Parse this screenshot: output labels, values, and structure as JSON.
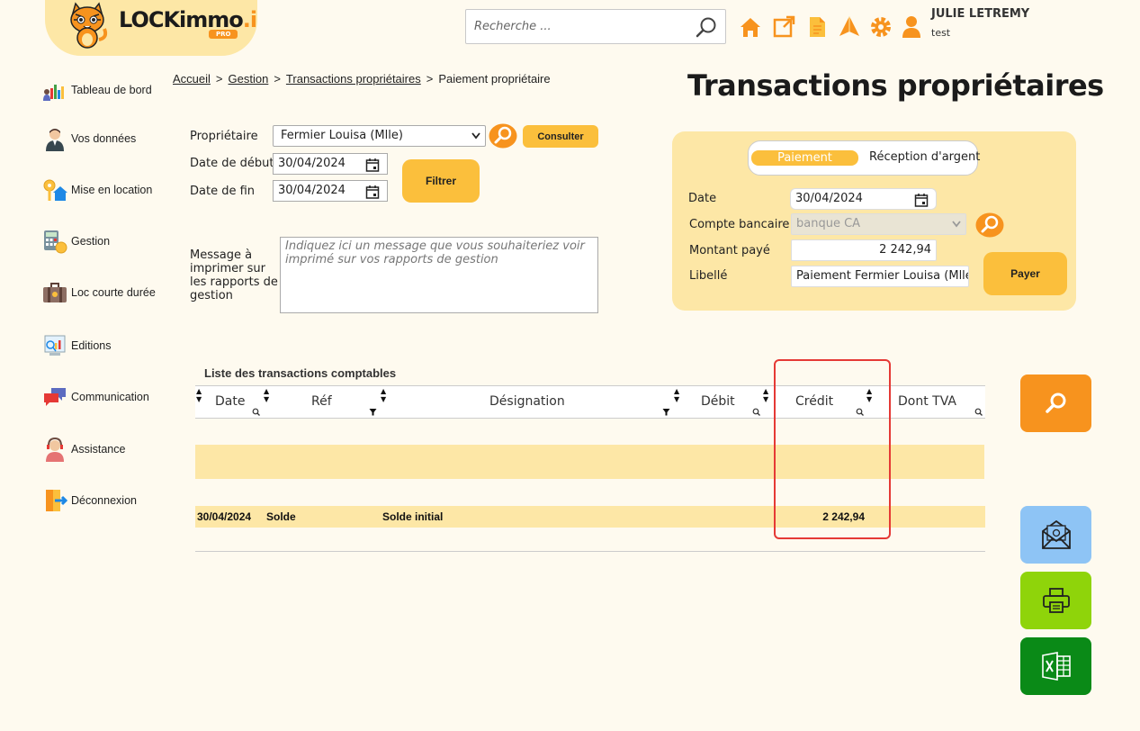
{
  "header": {
    "logo_text": "LOCKimmo",
    "logo_suffix": ".io",
    "logo_badge": "PRO",
    "search_placeholder": "Recherche ...",
    "user_name": "JULIE LETREMY",
    "user_sub": "test"
  },
  "sidebar": {
    "items": [
      {
        "label": "Tableau de bord",
        "icon": "dashboard-icon"
      },
      {
        "label": "Vos données",
        "icon": "person-icon"
      },
      {
        "label": "Mise en location",
        "icon": "key-house-icon"
      },
      {
        "label": "Gestion",
        "icon": "calculator-icon"
      },
      {
        "label": "Loc courte durée",
        "icon": "suitcase-icon"
      },
      {
        "label": "Editions",
        "icon": "report-icon"
      },
      {
        "label": "Communication",
        "icon": "chat-icon"
      },
      {
        "label": "Assistance",
        "icon": "support-icon"
      },
      {
        "label": "Déconnexion",
        "icon": "logout-icon"
      }
    ]
  },
  "breadcrumb": {
    "items": [
      "Accueil",
      "Gestion",
      "Transactions propriétaires"
    ],
    "current": "Paiement propriétaire",
    "separator": ">"
  },
  "page_title": "Transactions propriétaires",
  "filters": {
    "owner_label": "Propriétaire",
    "owner_value": "Fermier Louisa (Mlle)",
    "consult_label": "Consulter",
    "start_label": "Date de début",
    "start_value": "30/04/2024",
    "end_label": "Date de fin",
    "end_value": "30/04/2024",
    "filter_label": "Filtrer",
    "message_label": "Message à imprimer sur les rapports de gestion",
    "message_placeholder": "Indiquez ici un message que vous souhaiteriez voir imprimé sur vos rapports de gestion"
  },
  "payment": {
    "tab_active": "Paiement",
    "tab_other": "Réception d'argent",
    "date_label": "Date",
    "date_value": "30/04/2024",
    "account_label": "Compte bancaire",
    "account_value": "banque CA",
    "amount_label": "Montant payé",
    "amount_value": "2 242,94",
    "libelle_label": "Libellé",
    "libelle_value": "Paiement Fermier Louisa (Mlle)",
    "pay_label": "Payer"
  },
  "table": {
    "title": "Liste des transactions comptables",
    "columns": [
      "Date",
      "Réf",
      "Désignation",
      "Débit",
      "Crédit",
      "Dont TVA"
    ],
    "rows": [
      {
        "date": "30/04/2024",
        "ref": "Solde",
        "designation": "Solde initial",
        "debit": "",
        "credit": "2 242,94",
        "tva": ""
      }
    ]
  },
  "colors": {
    "accent": "#fbbf3c",
    "panel": "#fde7a6",
    "orange": "#f7931e",
    "highlight": "#e53935"
  },
  "actions": [
    "search-icon",
    "email-icon",
    "printer-icon",
    "excel-icon"
  ]
}
